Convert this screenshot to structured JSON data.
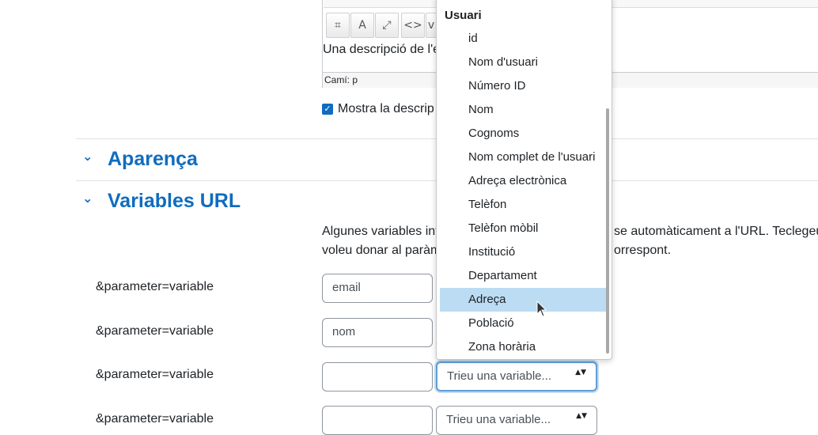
{
  "editor": {
    "content_text": "Una descripció de l'e",
    "path_label": "Camí: p",
    "toolbar_glyphs": [
      "⌗",
      "A",
      "⤢",
      "<>",
      "v"
    ]
  },
  "display_description": {
    "label": "Mostra la descrip",
    "checked": true,
    "check_glyph": "✓"
  },
  "sections": {
    "appearance": {
      "title": "Aparença",
      "chevron": "⌄"
    },
    "url_variables": {
      "title": "Variables URL",
      "chevron": "⌄"
    }
  },
  "url_variables_desc": {
    "line1_left": "Algunes variables int",
    "line1_right": "se automàticament a l'URL. Teclegeu",
    "line2_left": "voleu donar al paràm",
    "line2_right": "orrespont."
  },
  "params": [
    {
      "label": "&parameter=variable",
      "value": "email",
      "select": ""
    },
    {
      "label": "&parameter=variable",
      "value": "nom",
      "select": ""
    },
    {
      "label": "&parameter=variable",
      "value": "",
      "select": "Trieu una variable..."
    },
    {
      "label": "&parameter=variable",
      "value": "",
      "select": "Trieu una variable..."
    }
  ],
  "select_arrow": "▲▼",
  "dropdown": {
    "group_label": "Usuari",
    "items": [
      "id",
      "Nom d'usuari",
      "Número ID",
      "Nom",
      "Cognoms",
      "Nom complet de l'usuari",
      "Adreça electrònica",
      "Telèfon",
      "Telèfon mòbil",
      "Institució",
      "Departament",
      "Adreça",
      "Població",
      "Zona horària"
    ],
    "hovered": "Adreça"
  },
  "colors": {
    "accent": "#0f6cbf",
    "hover": "#bcdcf4"
  }
}
